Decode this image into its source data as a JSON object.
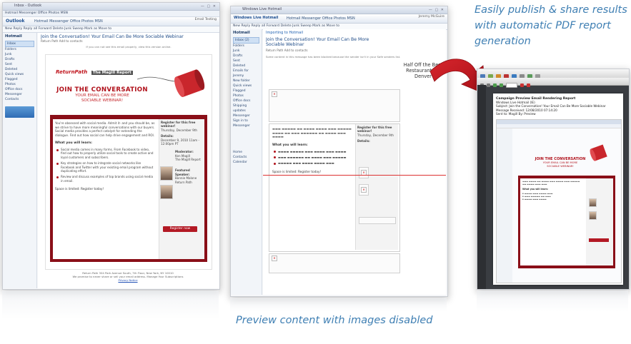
{
  "captions": {
    "right": "Easily publish & share results with automatic PDF report generation",
    "bottom": "Preview content with images disabled"
  },
  "left_screenshot": {
    "window_title": "Inbox - Outlook",
    "menu": "Hotmail   Messenger   Office   Photos   MSN",
    "brand": "Outlook",
    "tabs": "Hotmail   Messenger   Office   Photos   MSN",
    "user": "Email Testing",
    "toolbar_actions": "New   Reply   Reply all   Forward   Delete   Junk   Sweep   Mark as   Move to",
    "sidebar": {
      "heading": "Hotmail",
      "items": [
        "Inbox",
        "Folders",
        "Junk",
        "Drafts",
        "Sent",
        "Deleted",
        "Quick views",
        "Flagged",
        "Photos",
        "Office docs",
        "Messenger",
        "Contacts"
      ]
    },
    "subject": "Join the Conversation! Your Email Can Be More Sociable Webinar",
    "from_line": "Return Path   Add to contacts",
    "view_online": "If you can not see this email properly, view this version online.",
    "logo_brand": "ReturnPath",
    "logo_partner": "The Magill Report",
    "headline": "JOIN THE CONVERSATION",
    "subheadline_1": "YOUR EMAIL CAN BE MORE",
    "subheadline_2": "SOCIABLE WEBINAR!",
    "body_para": "You're obsessed with social media. Admit it- and you should be, as we strive to have more meaningful conversations with our buyers. Social media provides a perfect catalyst for extending the dialogue. Find out how social can help drive engagement and ROI.",
    "learn_heading": "What you will learn:",
    "bullets": [
      "Social media comes in many forms. From Facebook to video, find out how to properly utilize social tools to create active and loyal customers and subscribers.",
      "Key strategies on how to integrate social networks like Facebook and Twitter with your existing email program without duplicating effort.",
      "Review and discuss examples of top brands using social media in email."
    ],
    "space_limited": "Space is limited: Register today!",
    "register_title": "Register for this free webinar!",
    "register_date": "Thursday, December 9th",
    "details_label": "Details:",
    "details_text": "December 9, 2010 11am - 12:00pm PT",
    "moderator_label": "Moderator:",
    "moderator_name": "Ken Magill",
    "moderator_role": "The Magill Report",
    "speaker_label": "Featured Speaker:",
    "speaker_name": "Bonnie Malone",
    "speaker_role": "Return Path",
    "register_button": "Register now",
    "footer_1": "Return Path 304 Park Avenue South, 7th Floor, New York, NY 10010",
    "footer_2": "We promise to never share or sell your email address. Manage Your Subscriptions",
    "footer_link": "Privacy Notice"
  },
  "middle_screenshot": {
    "window_title": "Windows Live Hotmail",
    "tabs": "Hotmail   Messenger   Office   Photos   MSN",
    "user": "Jeremy McGuire",
    "sidebar_heading": "Hotmail",
    "sidebar_items": [
      "Inbox (2)",
      "Folders",
      "Junk",
      "Drafts",
      "Sent",
      "Deleted",
      "Emails for Jeremy",
      "New folder",
      "Quick views",
      "Flagged",
      "Photos",
      "Office docs",
      "Shipping updates",
      "Messenger",
      "Sign in to Messenger",
      "Home",
      "Contacts",
      "Calendar"
    ],
    "notice": "Importing to Hotmail",
    "subject": "Join the Conversation! Your Email Can Be More Sociable Webinar",
    "from_line": "Return Path   Add to contacts",
    "blocked_notice": "Some content in this message has been blocked because the sender isn't in your Safe senders list.",
    "half_off": "Half Off the Best Restaurants in Denver",
    "learn_heading": "What you will learn:",
    "space_limited": "Space is limited: Register today!",
    "register_title": "Register for this free webinar!",
    "register_date": "Thursday, December 9th",
    "details_label": "Details:"
  },
  "right_screenshot": {
    "pdf_title_1": "Campaign Preview Email Rendering Report",
    "pdf_title_2": "Windows Live Hotmail (IE)",
    "pdf_title_3": "Subject: Join the Conversation! Your Email Can Be More Sociable Webinar",
    "pdf_title_4": "Message Received: 12/08/2010 07:14:20",
    "pdf_title_5": "Sent to: Magill  By: Preview",
    "headline": "JOIN THE CONVERSATION",
    "subheadline_1": "YOUR EMAIL CAN BE MORE",
    "subheadline_2": "SOCIABLE WEBINAR!",
    "learn_heading": "What you will learn:"
  },
  "colors": {
    "caption": "#3f7fb3",
    "brand_red": "#8a0f18",
    "arrow_red": "#c3151c"
  }
}
